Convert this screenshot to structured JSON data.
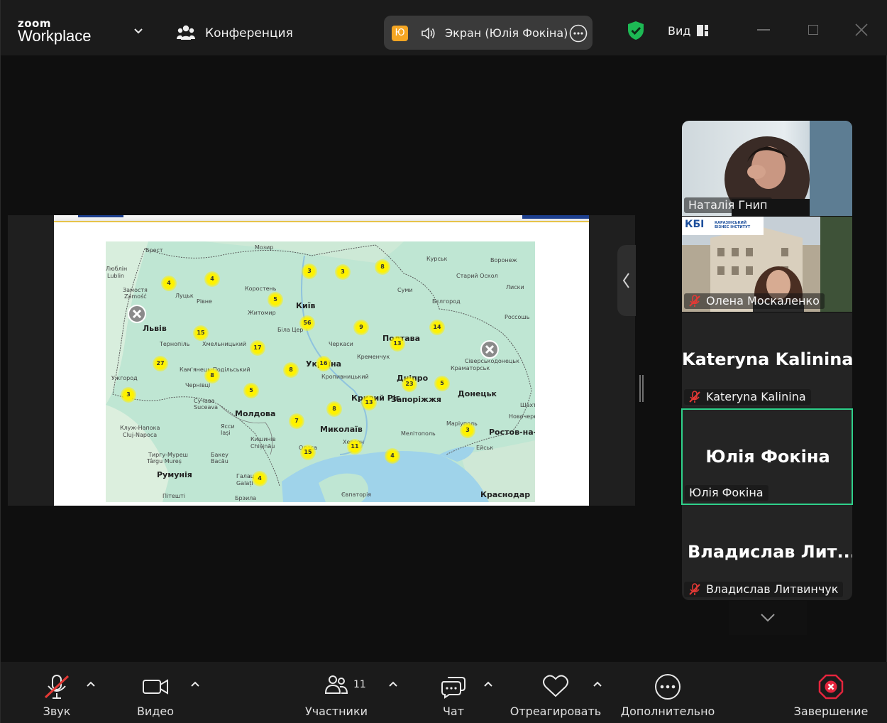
{
  "app": {
    "brand_small": "zoom",
    "brand_big": "Workplace",
    "meeting_label": "Конференция"
  },
  "share_pill": {
    "avatar_initial": "Ю",
    "label": "Экран (Юлія Фокіна)"
  },
  "topbar": {
    "view_label": "Вид"
  },
  "map": {
    "labels": [
      {
        "text": "Мозир"
      },
      {
        "text": "Брест"
      },
      {
        "text": "Люблін"
      },
      {
        "text": "Lublin"
      },
      {
        "text": "Курськ"
      },
      {
        "text": "Воронеж"
      },
      {
        "text": "Старий Оскол"
      },
      {
        "text": "Замостя"
      },
      {
        "text": "Zamość"
      },
      {
        "text": "Луцьк"
      },
      {
        "text": "Рівне"
      },
      {
        "text": "Коростень"
      },
      {
        "text": "Суми"
      },
      {
        "text": "Лиски"
      },
      {
        "text": "Київ"
      },
      {
        "text": "Житомир"
      },
      {
        "text": "Бєлгород"
      },
      {
        "text": "Львів"
      },
      {
        "text": "Біла Цер"
      },
      {
        "text": "Тернопіль"
      },
      {
        "text": "Хмельницький"
      },
      {
        "text": "Черкаси"
      },
      {
        "text": "Полтава"
      },
      {
        "text": "Россошь"
      },
      {
        "text": "Кременчук"
      },
      {
        "text": "Сіверськодонецьк"
      },
      {
        "text": "Краматорськ"
      },
      {
        "text": "Кам'янець-Подільський"
      },
      {
        "text": "Україна"
      },
      {
        "text": "Кропивницький"
      },
      {
        "text": "Ужгород"
      },
      {
        "text": "Чернівці"
      },
      {
        "text": "Дніпро"
      },
      {
        "text": "Донецьк"
      },
      {
        "text": "Кривий Ріг"
      },
      {
        "text": "Запоріжжя"
      },
      {
        "text": "Шахти"
      },
      {
        "text": "Сучава"
      },
      {
        "text": "Suceava"
      },
      {
        "text": "Молдова"
      },
      {
        "text": "Новочерк"
      },
      {
        "text": "Маріуполь"
      },
      {
        "text": "Ростов-на-Д"
      },
      {
        "text": "Клуж-Напока"
      },
      {
        "text": "Cluj-Napoca"
      },
      {
        "text": "Ясси"
      },
      {
        "text": "Iași"
      },
      {
        "text": "Миколаїв"
      },
      {
        "text": "Кишинів"
      },
      {
        "text": "Chișinău"
      },
      {
        "text": "Мелітополь"
      },
      {
        "text": "Ейськ"
      },
      {
        "text": "Тиргу-Муреш"
      },
      {
        "text": "Târgu Mureș"
      },
      {
        "text": "Бакеу"
      },
      {
        "text": "Bacău"
      },
      {
        "text": "Одеса"
      },
      {
        "text": "Херсон"
      },
      {
        "text": "Румунія"
      },
      {
        "text": "Галац"
      },
      {
        "text": "Galați"
      },
      {
        "text": "Краснодар"
      },
      {
        "text": "Євпаторія"
      },
      {
        "text": "Пітешті"
      },
      {
        "text": "Брэила"
      }
    ],
    "clusters": [
      {
        "value": "4"
      },
      {
        "value": "4"
      },
      {
        "value": "3"
      },
      {
        "value": "3"
      },
      {
        "value": "8"
      },
      {
        "value": "5"
      },
      {
        "value": "56"
      },
      {
        "value": "9"
      },
      {
        "value": "14"
      },
      {
        "value": "15"
      },
      {
        "value": "17"
      },
      {
        "value": "13"
      },
      {
        "value": "27"
      },
      {
        "value": "8"
      },
      {
        "value": "8"
      },
      {
        "value": "16"
      },
      {
        "value": "23"
      },
      {
        "value": "5"
      },
      {
        "value": "3"
      },
      {
        "value": "5"
      },
      {
        "value": "13"
      },
      {
        "value": "7"
      },
      {
        "value": "8"
      },
      {
        "value": "3"
      },
      {
        "value": "11"
      },
      {
        "value": "15"
      },
      {
        "value": "4"
      },
      {
        "value": "4"
      }
    ]
  },
  "participants": [
    {
      "name": "Наталія Гнип",
      "muted": false,
      "video": true
    },
    {
      "name": "Олена Москаленко",
      "muted": true,
      "video": true,
      "logo_text": "КБІ",
      "logo_sub": "КАРАЗІНСЬКИЙ БІЗНЕС ІНСТИТУТ"
    },
    {
      "name": "Kateryna Kalinina",
      "display_name": "Kateryna Kalinina",
      "muted": true,
      "video": false
    },
    {
      "name": "Юлія Фокіна",
      "display_name": "Юлія Фокіна",
      "muted": false,
      "video": false,
      "active_speaker": true
    },
    {
      "name": "Владислав Литвинчук",
      "display_name": "Владислав  Лит...",
      "muted": true,
      "video": false
    }
  ],
  "toolbar": {
    "audio_label": "Звук",
    "video_label": "Видео",
    "participants_label": "Участники",
    "participants_count": "11",
    "chat_label": "Чат",
    "react_label": "Отреагировать",
    "more_label": "Дополнительно",
    "end_label": "Завершение"
  },
  "colors": {
    "active_speaker_border": "#2fd18b",
    "mute_red": "#e53935",
    "end_red": "#e5253d",
    "avatar_orange": "#f5a623",
    "shield_green": "#1db954"
  }
}
